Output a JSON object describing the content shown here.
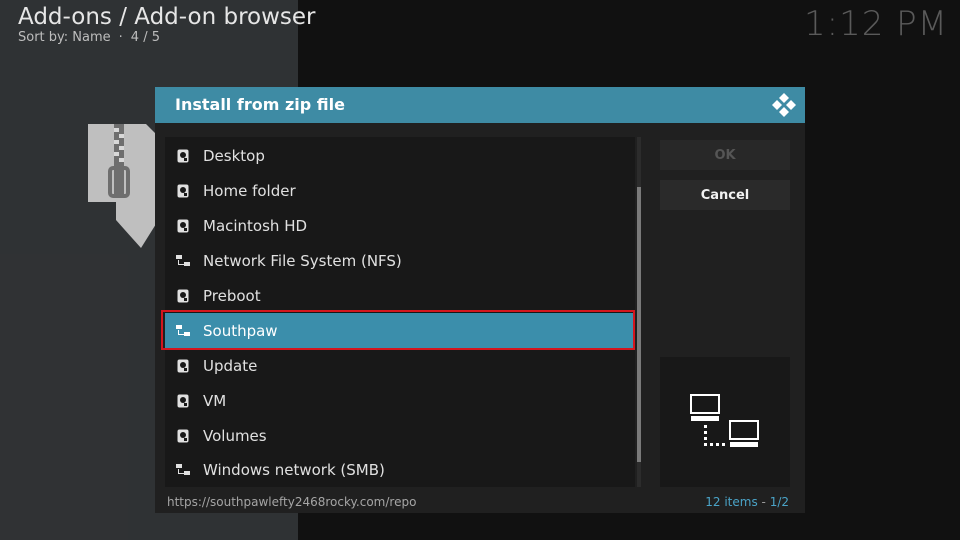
{
  "header": {
    "breadcrumb": "Add-ons / Add-on browser",
    "sort_label": "Sort by: Name",
    "position": "4 / 5",
    "clock": "1:12 PM"
  },
  "dialog": {
    "title": "Install from zip file",
    "items": [
      {
        "label": "Desktop",
        "icon": "drive-icon"
      },
      {
        "label": "Home folder",
        "icon": "drive-icon"
      },
      {
        "label": "Macintosh HD",
        "icon": "drive-icon"
      },
      {
        "label": "Network File System (NFS)",
        "icon": "network-icon"
      },
      {
        "label": "Preboot",
        "icon": "drive-icon"
      },
      {
        "label": "Southpaw",
        "icon": "network-icon",
        "selected": true
      },
      {
        "label": "Update",
        "icon": "drive-icon"
      },
      {
        "label": "VM",
        "icon": "drive-icon"
      },
      {
        "label": "Volumes",
        "icon": "drive-icon"
      },
      {
        "label": "Windows network (SMB)",
        "icon": "network-icon"
      }
    ],
    "ok_label": "OK",
    "cancel_label": "Cancel",
    "footer_path": "https://southpawlefty2468rocky.com/repo",
    "item_count": "12 items",
    "page": "1/2"
  },
  "colors": {
    "accent": "#3e8ba4",
    "selection": "#3b8eab",
    "highlight_border": "#d4161e"
  }
}
